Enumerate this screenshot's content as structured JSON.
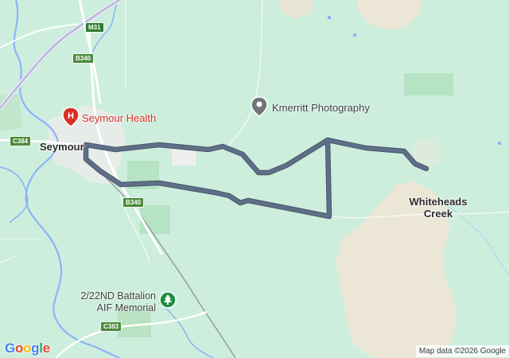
{
  "map": {
    "places": {
      "seymour": "Seymour",
      "whiteheads_creek_line1": "Whiteheads",
      "whiteheads_creek_line2": "Creek"
    },
    "pois": {
      "hospital": "Seymour Health",
      "photography": "Kmerritt Photography",
      "memorial_line1": "2/22ND Battalion",
      "memorial_line2": "AIF Memorial"
    },
    "roads": {
      "m31": "M31",
      "b340_north": "B340",
      "b340_south": "B340",
      "c384": "C384",
      "c383": "C383"
    },
    "logo": {
      "g1": "G",
      "o1": "o",
      "o2": "o",
      "g2": "g",
      "l": "l",
      "e": "e"
    },
    "attribution": "Map data ©2026 Google",
    "colors": {
      "land": "#cdeedd",
      "route": "#5e6f87",
      "route_border": "#47566b",
      "hospital": "#d93025",
      "memorial": "#1e8e3e",
      "sand": "#ece7d9",
      "water": "#8ab4f8"
    }
  }
}
